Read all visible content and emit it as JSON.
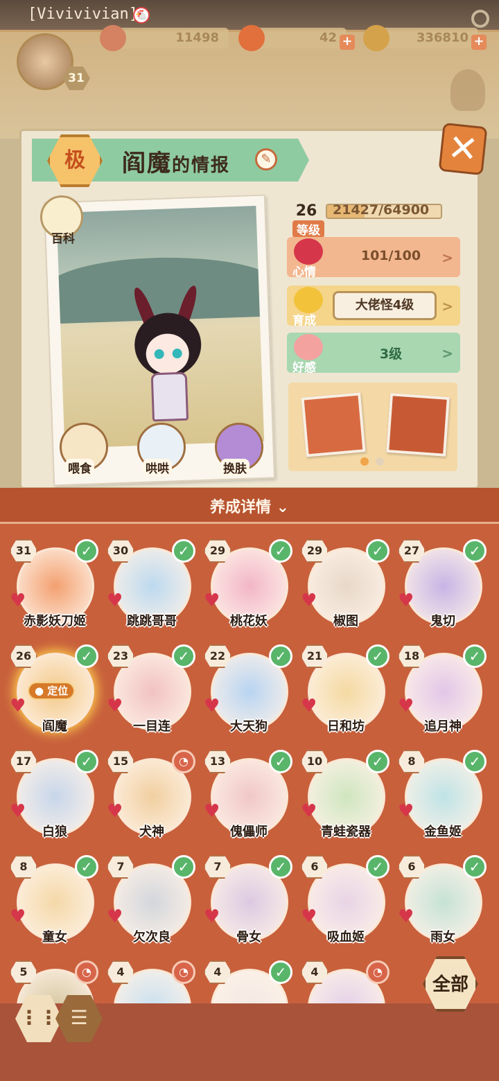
{
  "header": {
    "username": "[Vivivivian]",
    "player_level": "31",
    "resources": [
      {
        "icon": "cake-icon",
        "value": "11498"
      },
      {
        "icon": "magatama-icon",
        "value": "42"
      },
      {
        "icon": "coin-icon",
        "value": "336810"
      }
    ]
  },
  "info": {
    "rank": "极",
    "name": "阎魔",
    "name_suffix": "的情报",
    "encyclopedia_label": "百科",
    "level": "26",
    "level_label": "等级",
    "exp_text": "21427/64900",
    "exp_progress": 0.33,
    "mood_label": "心情",
    "mood_value": "101/100",
    "growth_label": "育成",
    "growth_value": "大佬怪4级",
    "affinity_label": "好感",
    "affinity_value": "3级",
    "actions": [
      {
        "label": "喂食"
      },
      {
        "label": "哄哄"
      },
      {
        "label": "换肤"
      }
    ]
  },
  "section_title": "养成详情",
  "cards": [
    {
      "level": "31",
      "name": "赤影妖刀姬",
      "status": "check",
      "color": "#f3a070"
    },
    {
      "level": "30",
      "name": "跳跳哥哥",
      "status": "check",
      "color": "#bcd9ef"
    },
    {
      "level": "29",
      "name": "桃花妖",
      "status": "check",
      "color": "#f2b6c8"
    },
    {
      "level": "29",
      "name": "椒图",
      "status": "check",
      "color": "#e7d8c9"
    },
    {
      "level": "27",
      "name": "鬼切",
      "status": "check",
      "color": "#c8b4e6"
    },
    {
      "level": "26",
      "name": "阎魔",
      "status": "check",
      "color": "#f3c98a",
      "locate": "定位"
    },
    {
      "level": "23",
      "name": "一目连",
      "status": "check",
      "color": "#f1c2c2"
    },
    {
      "level": "22",
      "name": "大天狗",
      "status": "check",
      "color": "#b8d4f2"
    },
    {
      "level": "21",
      "name": "日和坊",
      "status": "check",
      "color": "#f4d9a2"
    },
    {
      "level": "18",
      "name": "追月神",
      "status": "check",
      "color": "#e2c7e8"
    },
    {
      "level": "17",
      "name": "白狼",
      "status": "check",
      "color": "#c7d6ea"
    },
    {
      "level": "15",
      "name": "犬神",
      "status": "lock",
      "color": "#f1cfa0"
    },
    {
      "level": "13",
      "name": "傀儡师",
      "status": "check",
      "color": "#f0c7c7"
    },
    {
      "level": "10",
      "name": "青蛙瓷器",
      "status": "check",
      "color": "#cfe6c0"
    },
    {
      "level": "8",
      "name": "金鱼姬",
      "status": "check",
      "color": "#bfe3e6"
    },
    {
      "level": "8",
      "name": "童女",
      "status": "check",
      "color": "#f4d8a8"
    },
    {
      "level": "7",
      "name": "欠次良",
      "status": "check",
      "color": "#d3d6dc"
    },
    {
      "level": "7",
      "name": "骨女",
      "status": "check",
      "color": "#dcc9e2"
    },
    {
      "level": "6",
      "name": "吸血姬",
      "status": "check",
      "color": "#e8d4e6"
    },
    {
      "level": "6",
      "name": "雨女",
      "status": "check",
      "color": "#c6e2d6"
    },
    {
      "level": "5",
      "name": "",
      "status": "lock",
      "color": "#d6c7a0"
    },
    {
      "level": "4",
      "name": "",
      "status": "lock",
      "color": "#c9e0ef"
    },
    {
      "level": "4",
      "name": "",
      "status": "check",
      "color": "#f3e9e4"
    },
    {
      "level": "4",
      "name": "",
      "status": "lock",
      "color": "#e3d0e8"
    }
  ],
  "all_button": "全部"
}
